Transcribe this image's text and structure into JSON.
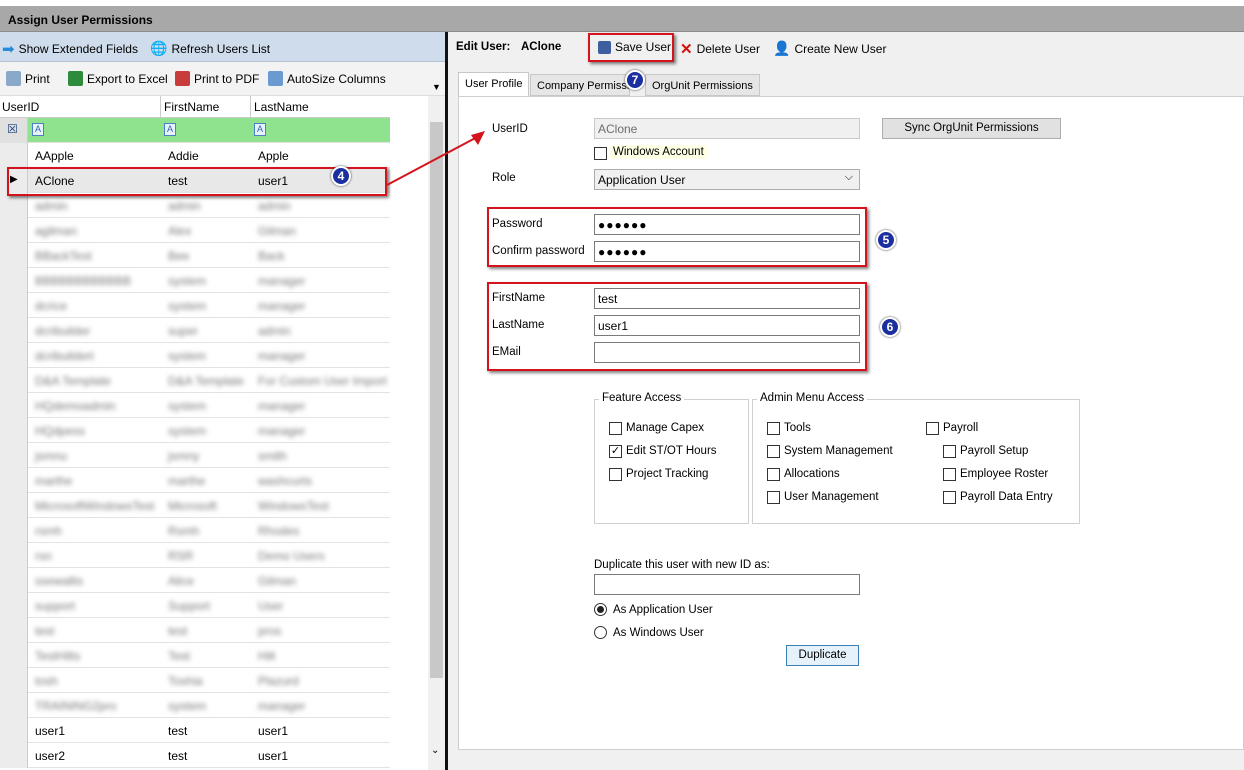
{
  "window": {
    "title": "Assign User Permissions"
  },
  "left_toolbar": {
    "show_extended": "Show Extended Fields",
    "refresh": "Refresh Users List",
    "print": "Print",
    "export_excel": "Export to Excel",
    "print_pdf": "Print to PDF",
    "autosize": "AutoSize Columns"
  },
  "grid": {
    "headers": [
      "UserID",
      "FirstName",
      "LastName"
    ],
    "rows": [
      {
        "userid": "AApple",
        "first": "Addie",
        "last": "Apple"
      },
      {
        "userid": "AClone",
        "first": "test",
        "last": "user1"
      },
      {
        "userid": "admin",
        "first": "admin",
        "last": "admin"
      },
      {
        "userid": "agilman",
        "first": "Alex",
        "last": "Gilman"
      },
      {
        "userid": "BBackTest",
        "first": "Bee",
        "last": "Back"
      },
      {
        "userid": "BBBBBBBBBBBB",
        "first": "system",
        "last": "manager"
      },
      {
        "userid": "dcrice",
        "first": "system",
        "last": "manager"
      },
      {
        "userid": "dcribuilder",
        "first": "super",
        "last": "admin"
      },
      {
        "userid": "dcribuildert",
        "first": "system",
        "last": "manager"
      },
      {
        "userid": "D&A Template",
        "first": "D&A Template",
        "last": "For Custom User Import"
      },
      {
        "userid": "HQdemoadmin",
        "first": "system",
        "last": "manager"
      },
      {
        "userid": "HQdpess",
        "first": "system",
        "last": "manager"
      },
      {
        "userid": "jsmnu",
        "first": "jsmny",
        "last": "smith"
      },
      {
        "userid": "marthe",
        "first": "marthe",
        "last": "washcurts"
      },
      {
        "userid": "MicrosoftWindowsTest",
        "first": "Microsoft",
        "last": "WindowsTest"
      },
      {
        "userid": "rsmh",
        "first": "Rsmh",
        "last": "Rhodes"
      },
      {
        "userid": "rsn",
        "first": "RSR",
        "last": "Demo Users"
      },
      {
        "userid": "ssewallis",
        "first": "Alice",
        "last": "Gilman"
      },
      {
        "userid": "support",
        "first": "Support",
        "last": "User"
      },
      {
        "userid": "test",
        "first": "test",
        "last": "pros"
      },
      {
        "userid": "TestHilts",
        "first": "Test",
        "last": "Hilt"
      },
      {
        "userid": "tosh",
        "first": "Toshia",
        "last": "Plazurd"
      },
      {
        "userid": "TRAINING2pro",
        "first": "system",
        "last": "manager"
      },
      {
        "userid": "user1",
        "first": "test",
        "last": "user1"
      },
      {
        "userid": "user2",
        "first": "test",
        "last": "user1"
      }
    ]
  },
  "right_toolbar": {
    "edit_user_label": "Edit User:",
    "edit_user_value": "AClone",
    "save": "Save User",
    "delete": "Delete User",
    "create": "Create New User"
  },
  "tabs": [
    "User Profile",
    "Company Permissions",
    "OrgUnit Permissions"
  ],
  "form": {
    "userid_label": "UserID",
    "userid_value": "AClone",
    "sync_button": "Sync OrgUnit Permissions",
    "windows_account": "Windows Account",
    "role_label": "Role",
    "role_value": "Application User",
    "password_label": "Password",
    "password_value": "●●●●●●",
    "confirm_label": "Confirm password",
    "confirm_value": "●●●●●●",
    "firstname_label": "FirstName",
    "firstname_value": "test",
    "lastname_label": "LastName",
    "lastname_value": "user1",
    "email_label": "EMail",
    "email_value": ""
  },
  "feature_access": {
    "title": "Feature Access",
    "items": [
      {
        "label": "Manage Capex",
        "checked": false
      },
      {
        "label": "Edit ST/OT Hours",
        "checked": true
      },
      {
        "label": "Project Tracking",
        "checked": false
      }
    ]
  },
  "admin_access": {
    "title": "Admin Menu Access",
    "col1": [
      "Tools",
      "System Management",
      "Allocations",
      "User Management"
    ],
    "payroll": "Payroll",
    "col2": [
      "Payroll Setup",
      "Employee Roster",
      "Payroll Data Entry"
    ]
  },
  "duplicate": {
    "label": "Duplicate this user with new ID as:",
    "radio_app": "As Application User",
    "radio_win": "As Windows User",
    "button": "Duplicate"
  },
  "callouts": [
    "4",
    "5",
    "6",
    "7"
  ],
  "colors": {
    "accent_red": "#d4141c",
    "badge_blue": "#1b2f9e",
    "filter_green": "#8fe38f"
  }
}
